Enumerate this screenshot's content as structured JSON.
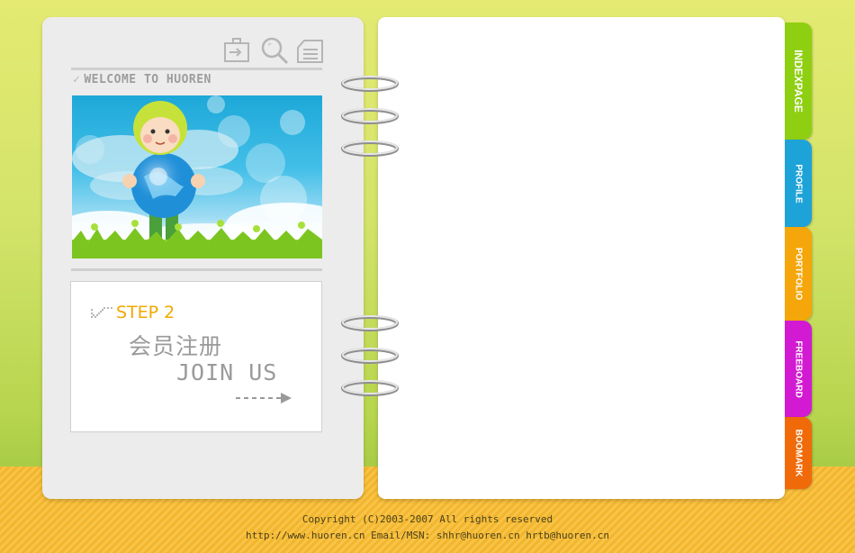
{
  "header": {
    "welcome": "WELCOME TO HUOREN",
    "icons": [
      "login-icon",
      "search-icon",
      "guestbook-icon"
    ]
  },
  "step_card": {
    "step": "STEP 2",
    "title_cn": "会员注册",
    "title_en": "JOIN US"
  },
  "tabs": [
    {
      "label": "INDEXPAGE",
      "color": "#8fcf12"
    },
    {
      "label": "PROFILE",
      "color": "#1ea3d8"
    },
    {
      "label": "PORTFOLIO",
      "color": "#f5a60a"
    },
    {
      "label": "FREEBOARD",
      "color": "#d21ad2"
    },
    {
      "label": "BOOMARK",
      "color": "#f06a0a"
    }
  ],
  "footer": {
    "copyright": "Copyright (C)2003-2007  All rights reserved",
    "contact": "http://www.huoren.cn  Email/MSN: shhr@huoren.cn hrtb@huoren.cn"
  },
  "colors": {
    "accent": "#f2a800",
    "background": "#d3e36a",
    "floor": "#f3b52e"
  }
}
